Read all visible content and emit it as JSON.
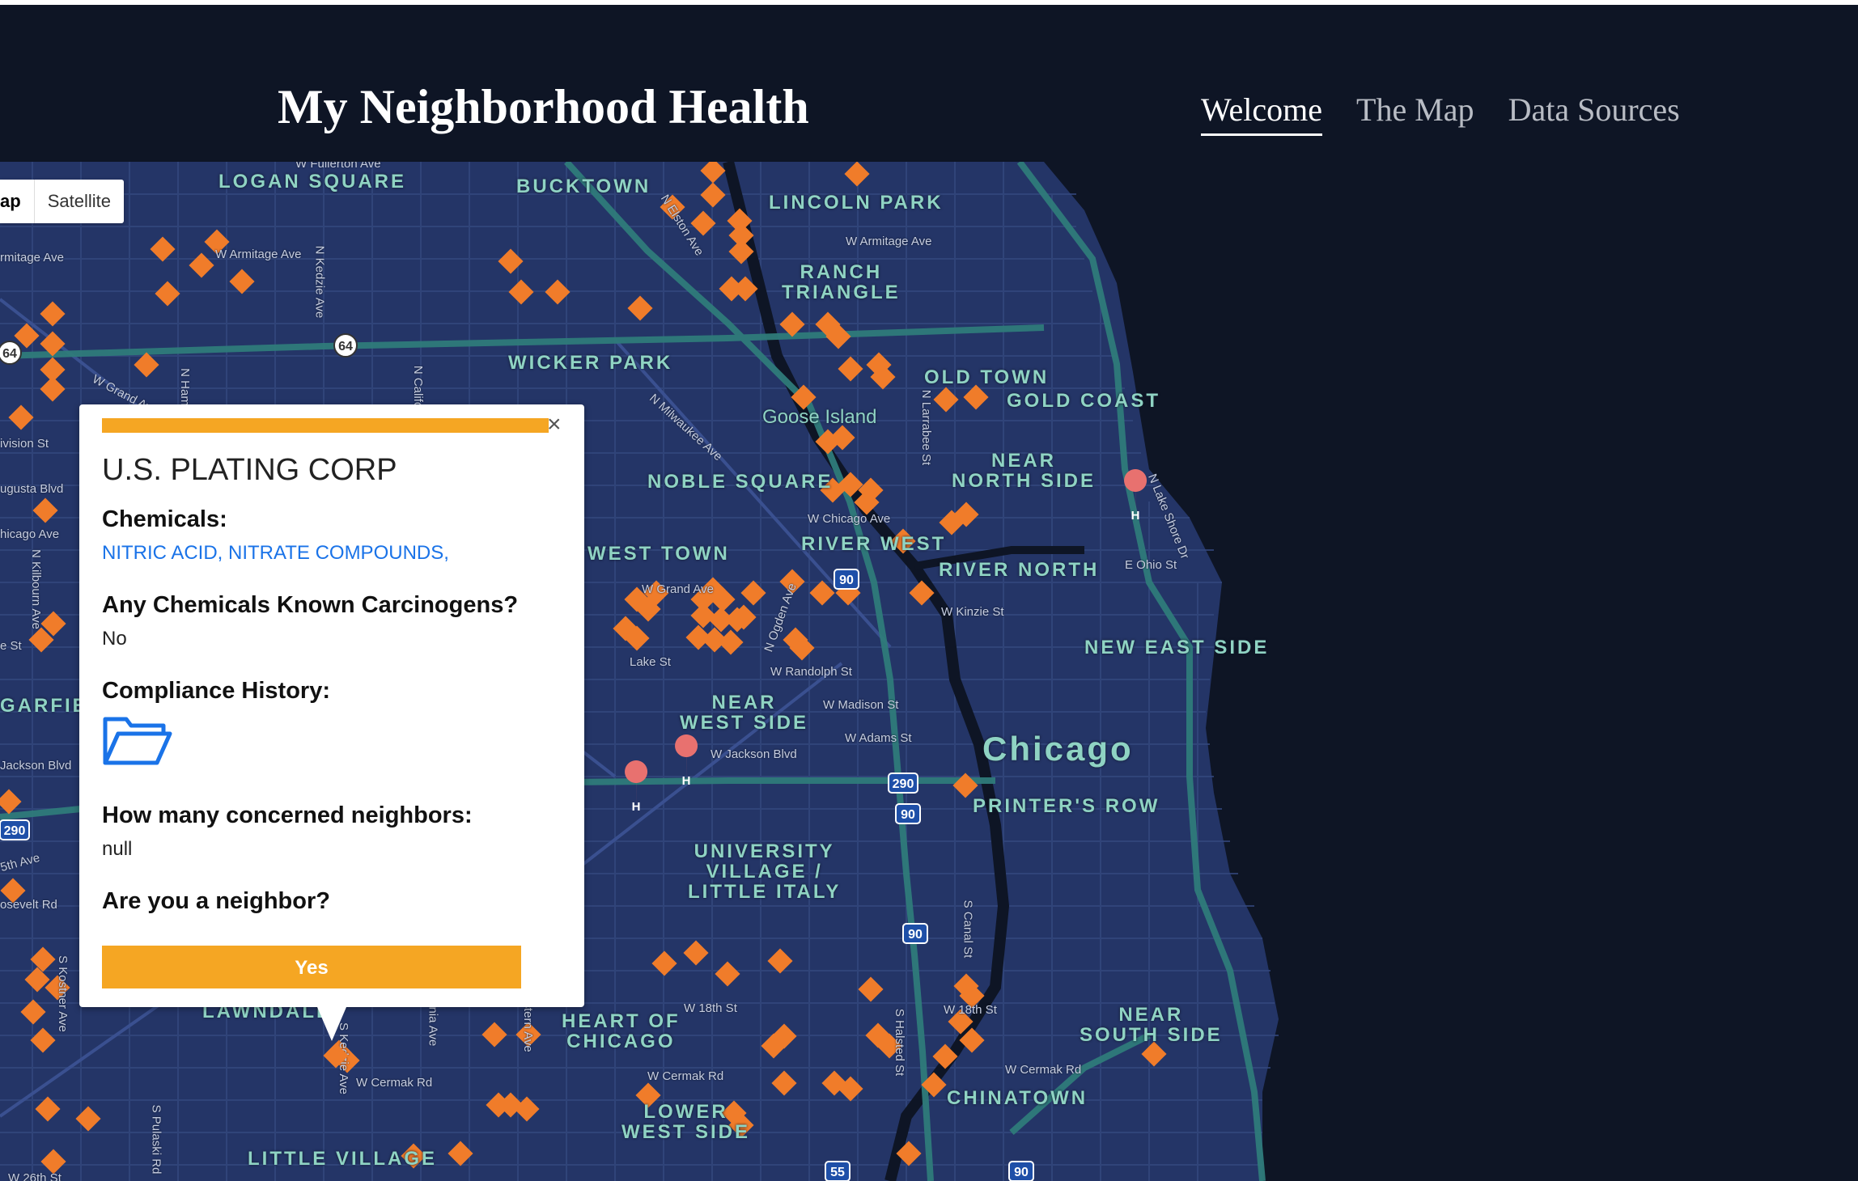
{
  "header": {
    "site_title": "My Neighborhood Health",
    "nav": [
      {
        "label": "Welcome",
        "active": true
      },
      {
        "label": "The Map",
        "active": false
      },
      {
        "label": "Data Sources",
        "active": false
      }
    ]
  },
  "map": {
    "map_type_control": {
      "map_label": "Map",
      "satellite_label": "Satellite"
    },
    "city_label": "Chicago",
    "neighborhoods": {
      "logan_square": "LOGAN SQUARE",
      "bucktown": "BUCKTOWN",
      "lincoln_park": "LINCOLN PARK",
      "ranch_triangle": "RANCH\nTRIANGLE",
      "wicker_park": "WICKER PARK",
      "old_town": "OLD TOWN",
      "gold_coast": "GOLD COAST",
      "near_north_side": "NEAR\nNORTH SIDE",
      "noble_square": "NOBLE SQUARE",
      "west_town": "WEST TOWN",
      "river_west": "RIVER WEST",
      "river_north": "RIVER NORTH",
      "new_east_side": "NEW EAST SIDE",
      "near_west_side": "NEAR\nWEST SIDE",
      "printers_row": "PRINTER'S ROW",
      "university_village": "UNIVERSITY\nVILLAGE /\nLITTLE ITALY",
      "heart_of_chicago": "HEART OF\nCHICAGO",
      "near_south_side": "NEAR\nSOUTH SIDE",
      "lower_west_side": "LOWER\nWEST SIDE",
      "chinatown": "CHINATOWN",
      "little_village": "LITTLE VILLAGE",
      "lawndale": "LAWNDALE",
      "garfield": "GARFIE",
      "goose_island": "Goose Island"
    },
    "streets": {
      "fullerton": "W Fullerton Ave",
      "armitage_left": "rmitage Ave",
      "armitage": "W Armitage Ave",
      "armitage_right": "W Armitage Ave",
      "kedzie": "N Kedzie Ave",
      "grand": "W Grand Ave",
      "division": "ivision St",
      "augusta": "ugusta Blvd",
      "chicago": "hicago Ave",
      "w_chicago": "W Chicago Ave",
      "kilbourn": "N Kilbourn Ave",
      "milwaukee": "N Milwaukee Ave",
      "elston": "N Elston Ave",
      "larrabee": "N Larrabee St",
      "lake_shore": "N Lake Shore Dr",
      "ohio": "E Ohio St",
      "kinzie": "W Kinzie St",
      "lake": "Lake St",
      "w_grand_2": "W Grand Ave",
      "ogden": "N Ogden Ave",
      "randolph": "W Randolph St",
      "madison": "W Madison St",
      "adams": "W Adams St",
      "jackson": "W Jackson Blvd",
      "jackson_left": "Jackson Blvd",
      "fifth": "5th Ave",
      "roosevelt": "osevelt Rd",
      "kostner": "S Kostner Ave",
      "w18th": "W 18th St",
      "w18th_2": "W 18th St",
      "cermak": "W Cermak Rd",
      "cermak_2": "W Cermak Rd",
      "cermak_3": "W Cermak Rd",
      "canal": "S Canal St",
      "halsted": "S Halsted St",
      "california": "ifornia Ave",
      "western": "Western Ave",
      "pulaski": "S Pulaski Rd",
      "kedzie_s": "S Kedzie Ave",
      "hamlin": "N Ham",
      "n_cali": "N Califo",
      "w26th": "W 26th St",
      "ce_st": "e St"
    },
    "shields": [
      "64",
      "64",
      "90",
      "290",
      "90",
      "290",
      "90",
      "55",
      "90"
    ]
  },
  "popup": {
    "title": "U.S. PLATING CORP",
    "chemicals_label": "Chemicals:",
    "chemicals_value": "NITRIC ACID, NITRATE COMPOUNDS,",
    "carcinogen_label": "Any Chemicals Known Carcinogens?",
    "carcinogen_value": "No",
    "compliance_label": "Compliance History:",
    "compliance_icon": "folder-open-icon",
    "neighbors_label": "How many concerned neighbors:",
    "neighbors_value": "null",
    "neighbor_question": "Are you a neighbor?",
    "yes_label": "Yes",
    "close_symbol": "×",
    "accent_color": "#f5a623"
  },
  "colors": {
    "header_bg": "#0e1525",
    "map_land": "#243567",
    "map_water": "#0e1525",
    "highway": "#2f7b7a",
    "marker": "#f07c2a",
    "label": "#8fd3c3"
  }
}
